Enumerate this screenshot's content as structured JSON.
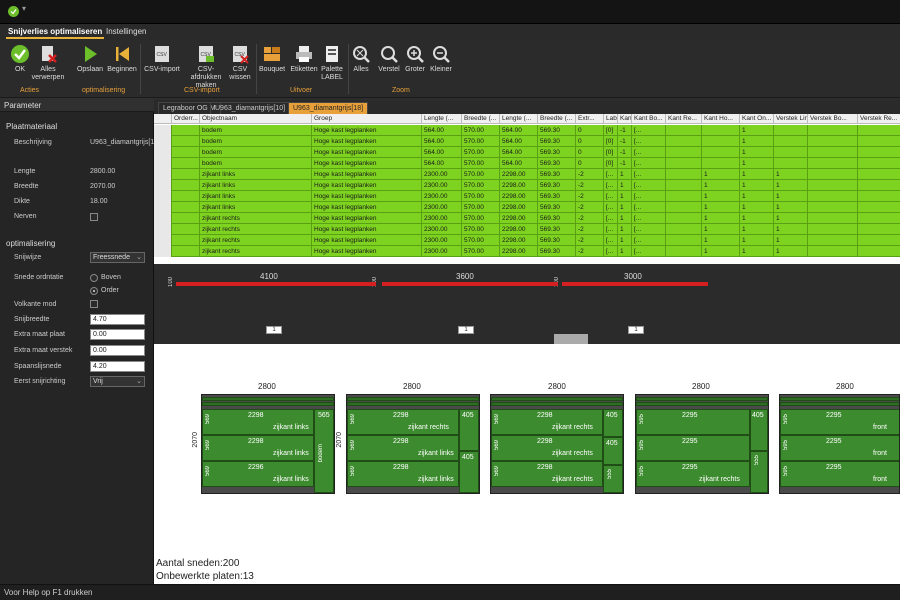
{
  "ribbon": {
    "tabs": [
      "Snijverlies optimaliseren",
      "Instellingen"
    ],
    "buttons": {
      "ok": "OK",
      "all_discard": "Alles verwerpen",
      "save": "Opslaan",
      "start": "Beginnen",
      "csv_import": "CSV-import",
      "csv_print": "CSV-afdrukken maken",
      "csv_delete": "CSV wissen",
      "bouquet": "Bouquet",
      "labels": "Etiketten",
      "palette_label": "Palette LABEL",
      "all": "Alles",
      "reduce": "Verstel",
      "larger": "Groter",
      "smaller": "Kleiner"
    },
    "groups": {
      "acties": "Acties",
      "optimalisering": "optimalisering",
      "csv_import": "CSV-import",
      "uitvoer": "Uitvoer",
      "zoom": "Zoom"
    }
  },
  "left_panel": {
    "title": "Parameter",
    "plaatmateriaal": "Plaatmateriaal",
    "beschrijving_label": "Beschrijving",
    "beschrijving_value": "U963_diamantgrijs[1(",
    "lengte_label": "Lengte",
    "lengte_value": "2800.00",
    "breedte_label": "Breedte",
    "breedte_value": "2070.00",
    "dikte_label": "Dikte",
    "dikte_value": "18.00",
    "nerven_label": "Nerven",
    "optimalisering": "optimalisering",
    "snijwijze_label": "Snijwijze",
    "snijwijze_value": "Freessnede",
    "snede_label": "Snede ordntatie",
    "snede_opt1": "Boven",
    "snede_opt2": "Order",
    "volkante_label": "Volkante mod",
    "snijbreedte_label": "Snijbreedte",
    "snijbreedte_value": "4.70",
    "extra_plaat_label": "Extra maat plaat",
    "extra_plaat_value": "0.00",
    "extra_verstek_label": "Extra maat verstek",
    "extra_verstek_value": "0.00",
    "spaanslijsnede_label": "Spaanslijsnede",
    "spaanslijsnede_value": "4.20",
    "eerst_label": "Eerst snijrichting",
    "eerst_value": "Vrij"
  },
  "doc_tabs": [
    "Legraboor OG M",
    "U963_diamantgrijs[10]",
    "U963_diamantgrijs[18]"
  ],
  "grid": {
    "headers": [
      "Orderr...",
      "Objectnaam",
      "Groep",
      "Lengte (...",
      "Breedte (...",
      "Lengte (...",
      "Breedte (...",
      "Extr...",
      "Lab...",
      "Kant Lin...",
      "Kant Bo...",
      "Kant Re...",
      "Kant Ho...",
      "Kant On...",
      "Verstek Lin...",
      "Verstek Bo...",
      "Verstek Re..."
    ],
    "rows": [
      [
        "",
        "bodem",
        "Hoge kast legplanken",
        "564.00",
        "570.00",
        "564.00",
        "569.30",
        "0",
        "[0]",
        "-1",
        "[...",
        "",
        "",
        "1",
        "",
        "",
        ""
      ],
      [
        "",
        "bodem",
        "Hoge kast legplanken",
        "564.00",
        "570.00",
        "564.00",
        "569.30",
        "0",
        "[0]",
        "-1",
        "[...",
        "",
        "",
        "1",
        "",
        "",
        ""
      ],
      [
        "",
        "bodem",
        "Hoge kast legplanken",
        "564.00",
        "570.00",
        "564.00",
        "569.30",
        "0",
        "[0]",
        "-1",
        "[...",
        "",
        "",
        "1",
        "",
        "",
        ""
      ],
      [
        "",
        "bodem",
        "Hoge kast legplanken",
        "564.00",
        "570.00",
        "564.00",
        "569.30",
        "0",
        "[0]",
        "-1",
        "[...",
        "",
        "",
        "1",
        "",
        "",
        ""
      ],
      [
        "",
        "zijkant links",
        "Hoge kast legplanken",
        "2300.00",
        "570.00",
        "2298.00",
        "569.30",
        "-2",
        "[...",
        "1",
        "[...",
        "",
        "1",
        "1",
        "1",
        "",
        ""
      ],
      [
        "",
        "zijkant links",
        "Hoge kast legplanken",
        "2300.00",
        "570.00",
        "2298.00",
        "569.30",
        "-2",
        "[...",
        "1",
        "[...",
        "",
        "1",
        "1",
        "1",
        "",
        ""
      ],
      [
        "",
        "zijkant links",
        "Hoge kast legplanken",
        "2300.00",
        "570.00",
        "2298.00",
        "569.30",
        "-2",
        "[...",
        "1",
        "[...",
        "",
        "1",
        "1",
        "1",
        "",
        ""
      ],
      [
        "",
        "zijkant links",
        "Hoge kast legplanken",
        "2300.00",
        "570.00",
        "2298.00",
        "569.30",
        "-2",
        "[...",
        "1",
        "[...",
        "",
        "1",
        "1",
        "1",
        "",
        ""
      ],
      [
        "",
        "zijkant rechts",
        "Hoge kast legplanken",
        "2300.00",
        "570.00",
        "2298.00",
        "569.30",
        "-2",
        "[...",
        "1",
        "[...",
        "",
        "1",
        "1",
        "1",
        "",
        ""
      ],
      [
        "",
        "zijkant rechts",
        "Hoge kast legplanken",
        "2300.00",
        "570.00",
        "2298.00",
        "569.30",
        "-2",
        "[...",
        "1",
        "[...",
        "",
        "1",
        "1",
        "1",
        "",
        ""
      ],
      [
        "",
        "zijkant rechts",
        "Hoge kast legplanken",
        "2300.00",
        "570.00",
        "2298.00",
        "569.30",
        "-2",
        "[...",
        "1",
        "[...",
        "",
        "1",
        "1",
        "1",
        "",
        ""
      ],
      [
        "",
        "zijkant rechts",
        "Hoge kast legplanken",
        "2300.00",
        "570.00",
        "2298.00",
        "569.30",
        "-2",
        "[...",
        "1",
        "[...",
        "",
        "1",
        "1",
        "1",
        "",
        ""
      ]
    ]
  },
  "timeline": {
    "seg1": "4100",
    "seg2": "3600",
    "seg3": "3000",
    "tick": "100",
    "box": "1"
  },
  "sheets": {
    "width_label": "2800",
    "height_label": "2070",
    "piece_2298": "2298",
    "piece_2296": "2296",
    "piece_2295": "2295",
    "zijkant_links": "zijkant links",
    "zijkant_rechts": "zijkant rechts",
    "front": "front",
    "bodem": "bodem",
    "w405": "405",
    "w565": "565",
    "w569": "569",
    "w595": "595",
    "w555": "555"
  },
  "stats": {
    "sneden": "Aantal sneden:200",
    "platen": "Onbewerkte platen:13"
  },
  "status": "Voor Help op F1 drukken"
}
